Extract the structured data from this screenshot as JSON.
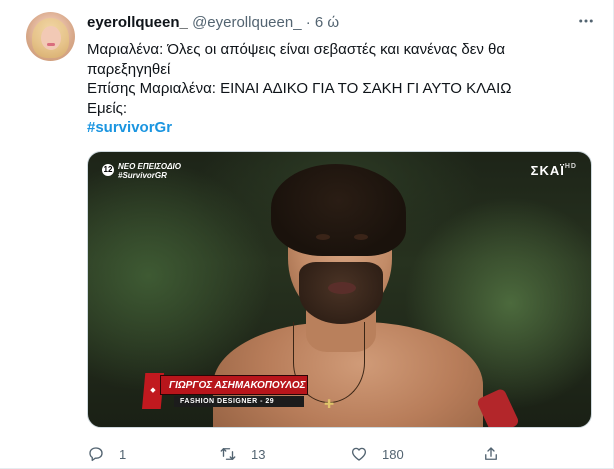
{
  "tweet": {
    "display_name": "eyerollqueen_",
    "handle": "@eyerollqueen_",
    "separator": "·",
    "time": "6 ώ",
    "more_icon": "more-horizontal-icon",
    "lines": [
      "Μαριαλένα: Όλες οι απόψεις είναι σεβαστές και κανένας δεν θα",
      "παρεξηγηθεί",
      "Επίσης Μαριαλένα: ΕΙΝΑΙ ΑΔΙΚΟ ΓΙΑ ΤΟ ΣΑΚΗ ΓΙ ΑΥΤΟ ΚΛΑΙΩ",
      "Εμείς:"
    ],
    "hashtag": "#survivorGr",
    "hashtag_color": "#1b95e0"
  },
  "media": {
    "channel_number": "12",
    "promo_line1": "ΝΕΟ ΕΠΕΙΣΟΔΙΟ",
    "promo_line2": "#SurvivorGR",
    "broadcaster": "ΣΚΑΪ",
    "broadcaster_hd": "HD",
    "lower_third_name": "ΓΙΩΡΓΟΣ ΑΣΗΜΑΚΟΠΟΥΛΟΣ",
    "lower_third_subtitle": "FASHION DESIGNER - 29"
  },
  "actions": {
    "reply_icon": "reply-icon",
    "reply_count": "1",
    "retweet_icon": "retweet-icon",
    "retweet_count": "13",
    "like_icon": "heart-icon",
    "like_count": "180",
    "share_icon": "share-icon"
  },
  "colors": {
    "text_primary": "#0f1419",
    "text_secondary": "#536471",
    "link": "#1b95e0"
  }
}
